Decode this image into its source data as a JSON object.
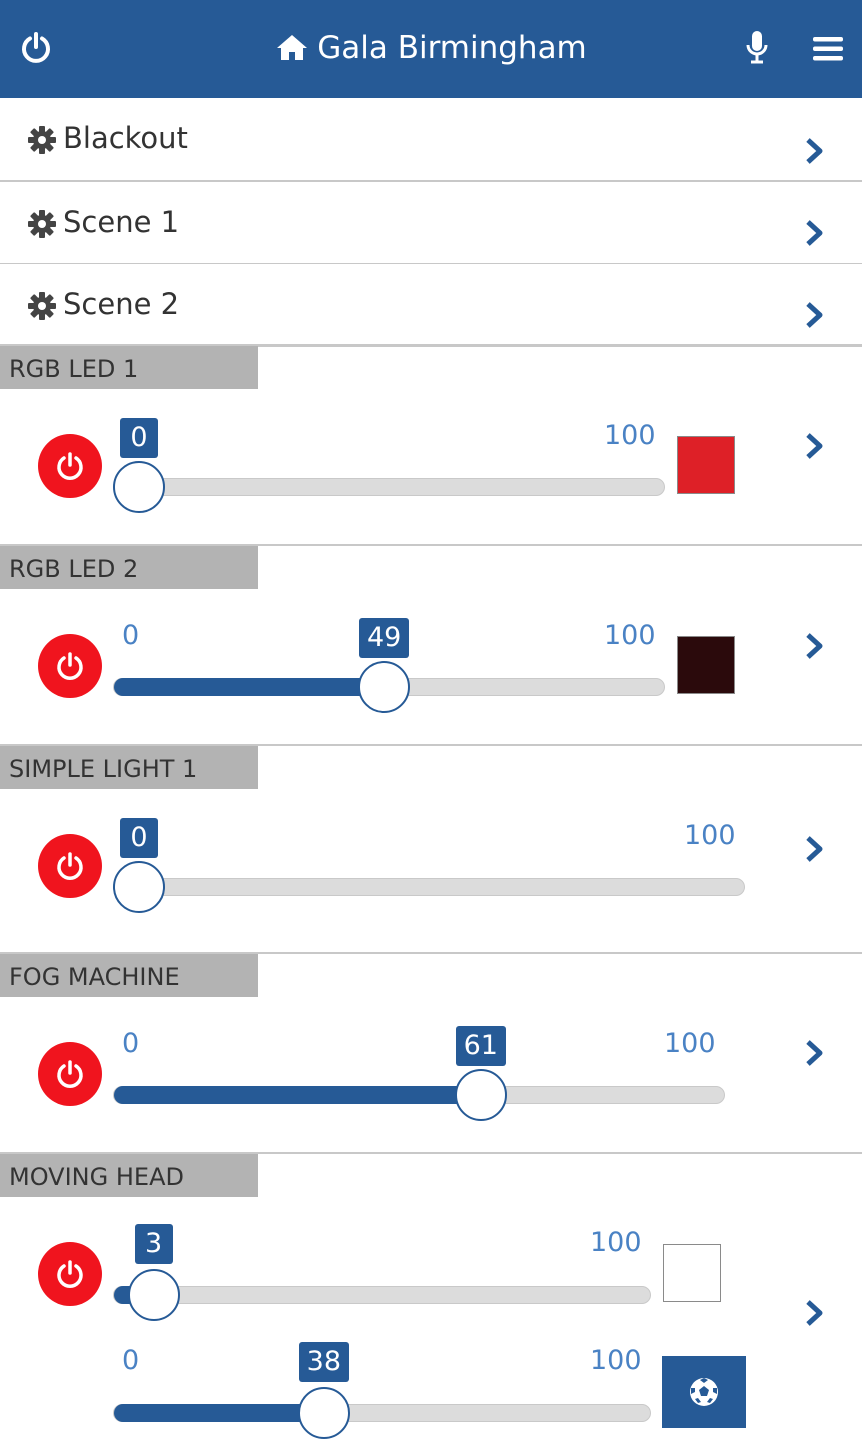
{
  "header": {
    "title": "Gala Birmingham",
    "left_icon": "power-icon",
    "title_icon": "home-icon",
    "right_icons": [
      "microphone-icon",
      "menu-icon"
    ],
    "background": "#265a96"
  },
  "scenes": [
    {
      "label": "Blackout",
      "icon": "gear-icon"
    },
    {
      "label": "Scene 1",
      "icon": "gear-icon"
    },
    {
      "label": "Scene 2",
      "icon": "gear-icon"
    }
  ],
  "devices": [
    {
      "name": "RGB LED 1",
      "slider": {
        "min": "0",
        "max": "100",
        "value": "0",
        "min_label_visible": false
      },
      "color": "#de2027"
    },
    {
      "name": "RGB LED 2",
      "slider": {
        "min": "0",
        "max": "100",
        "value": "49",
        "min_label_visible": true
      },
      "color": "#2b0a0c"
    },
    {
      "name": "SIMPLE LIGHT 1",
      "slider": {
        "min": "0",
        "max": "100",
        "value": "0",
        "min_label_visible": false
      }
    },
    {
      "name": "FOG MACHINE",
      "slider": {
        "min": "0",
        "max": "100",
        "value": "61",
        "min_label_visible": true
      }
    },
    {
      "name": "MOVING HEAD",
      "slider": {
        "min": "0",
        "max": "100",
        "value": "3",
        "min_label_visible": false
      },
      "slider2": {
        "min": "0",
        "max": "100",
        "value": "38",
        "min_label_visible": true
      },
      "color": "#ffffff",
      "effect_icon": "soccer-ball-icon"
    }
  ],
  "colors": {
    "accent": "#265a96",
    "power": "#f0141e",
    "value_label": "#4a82c4"
  }
}
